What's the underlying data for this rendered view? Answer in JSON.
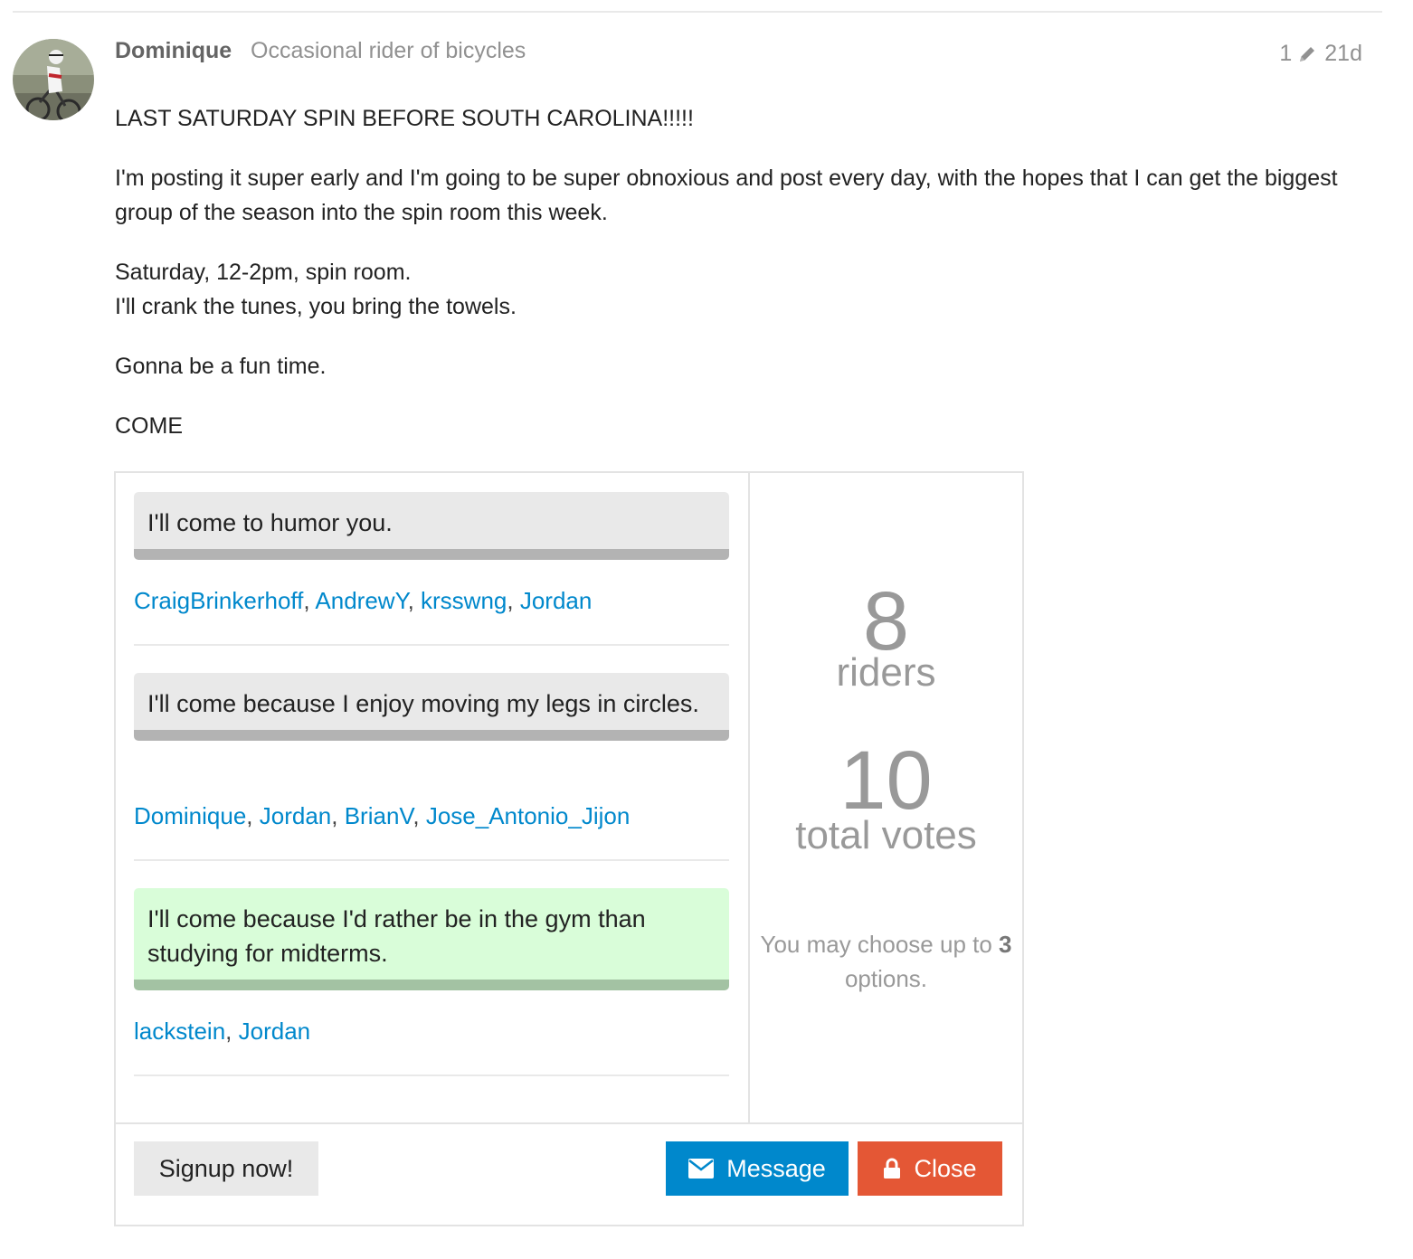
{
  "post": {
    "username": "Dominique",
    "user_title": "Occasional rider of bicycles",
    "edit_count": "1",
    "age": "21d",
    "icons": {
      "avatar": "avatar-photo",
      "edit": "pencil-icon"
    },
    "paragraphs": [
      "LAST SATURDAY SPIN BEFORE SOUTH CAROLINA!!!!!",
      "I'm posting it super early and I'm going to be super obnoxious and post every day, with the hopes that I can get the biggest group of the season into the spin room this week.",
      "Saturday, 12-2pm, spin room.",
      "I'll crank the tunes, you bring the towels.",
      "Gonna be a fun time.",
      "COME"
    ]
  },
  "poll": {
    "options": [
      {
        "text": "I'll come to humor you.",
        "chosen": false,
        "voters": [
          "CraigBrinkerhoff",
          "AndrewY",
          "krsswng",
          "Jordan"
        ]
      },
      {
        "text": "I'll come because I enjoy moving my legs in circles.",
        "chosen": false,
        "voters": [
          "Dominique",
          "Jordan",
          "BrianV",
          "Jose_Antonio_Jijon"
        ]
      },
      {
        "text": "I'll come because I'd rather be in the gym than studying for midterms.",
        "chosen": true,
        "voters": [
          "lackstein",
          "Jordan"
        ]
      }
    ],
    "voter_separator": ", ",
    "riders_count": "8",
    "riders_label": "riders",
    "votes_count": "10",
    "votes_label": "total votes",
    "choose_prefix": "You may choose up to ",
    "choose_max": "3",
    "choose_suffix": " options.",
    "colors": {
      "link": "#0088cc",
      "chosen_bg": "#d9fdd9",
      "message_button": "#0088cc",
      "close_button": "#e45735"
    },
    "buttons": {
      "signup": "Signup now!",
      "message": "Message",
      "message_icon": "envelope-icon",
      "close": "Close",
      "close_icon": "lock-icon"
    }
  }
}
